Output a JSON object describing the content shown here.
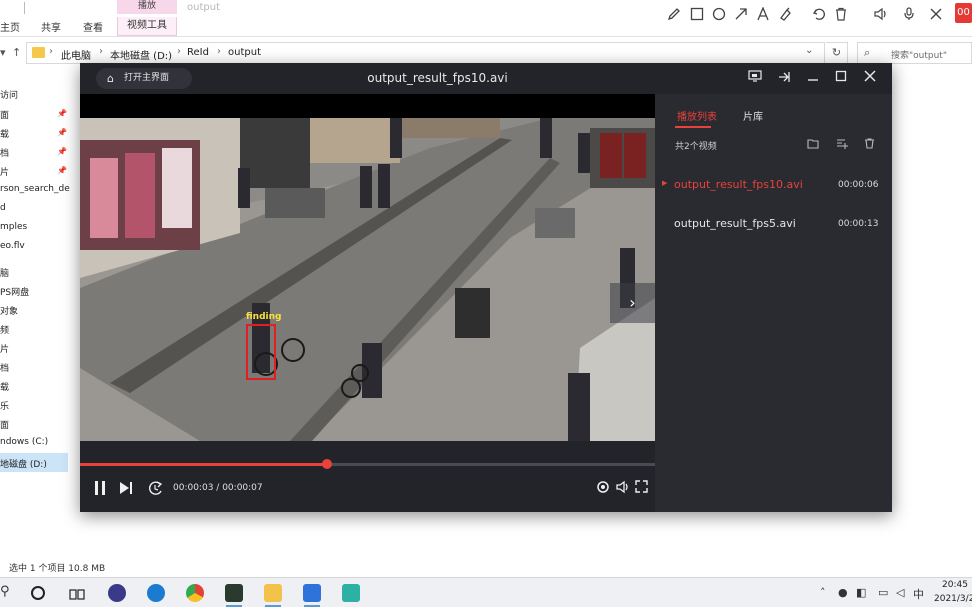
{
  "ribbon": {
    "home": "主页",
    "share": "共享",
    "view": "查看",
    "context_group": "播放",
    "context_tab": "视频工具",
    "ghost_title": "output",
    "record_label": "00"
  },
  "annotation_tools": [
    "pen-icon",
    "rect-icon",
    "circle-icon",
    "arrow-icon",
    "text-icon",
    "highlighter-icon",
    "undo-icon",
    "trash-icon",
    "speaker-icon",
    "mic-icon",
    "close-icon"
  ],
  "address": {
    "crumbs": [
      "此电脑",
      "本地磁盘 (D:)",
      "ReId",
      "output"
    ],
    "search_placeholder": "搜索\"output\""
  },
  "nav_pane": {
    "items": [
      "访问",
      "面",
      "载",
      "档",
      "片",
      "rson_search_de",
      "d",
      "mples",
      "eo.flv",
      "脑",
      "PS网盘",
      "对象",
      "频",
      "片",
      "档",
      "载",
      "乐",
      "面",
      "ndows (C:)",
      "地磁盘 (D:)"
    ],
    "status": "选中 1 个项目  10.8 MB"
  },
  "player": {
    "home_button": "打开主界面",
    "title": "output_result_fps10.avi",
    "detection_label": "finding",
    "time_current": "00:00:03",
    "time_total": "00:00:07",
    "progress_fraction": 0.43,
    "accent_color": "#e8423a",
    "sidebar": {
      "tab_playlist": "播放列表",
      "tab_library": "片库",
      "count": "共2个视频",
      "items": [
        {
          "name": "output_result_fps10.avi",
          "duration": "00:00:06",
          "active": true
        },
        {
          "name": "output_result_fps5.avi",
          "duration": "00:00:13",
          "active": false
        }
      ]
    }
  },
  "tray": {
    "ime_char": "中",
    "time": "20:45",
    "date": "2021/3/2"
  }
}
